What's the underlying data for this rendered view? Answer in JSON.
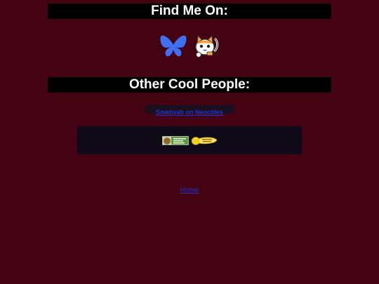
{
  "headings": {
    "find_me": "Find Me On:",
    "cool_people": "Other Cool People:"
  },
  "social_links": [
    {
      "icon": "bluesky-butterfly-icon",
      "color": "#3f6ff2"
    },
    {
      "icon": "neocities-cat-icon",
      "color": "#f0a040"
    }
  ],
  "cool_people": {
    "link_label": "Smkhyah on Neocities"
  },
  "badges": [
    {
      "icon": "snail-badge-icon"
    },
    {
      "icon": "lemon-badge-icon"
    }
  ],
  "footer": {
    "home_label": "Home"
  },
  "colors": {
    "background": "#430312",
    "heading_bar": "#000000",
    "link": "#2233cc",
    "panel": "#0e0a18"
  }
}
